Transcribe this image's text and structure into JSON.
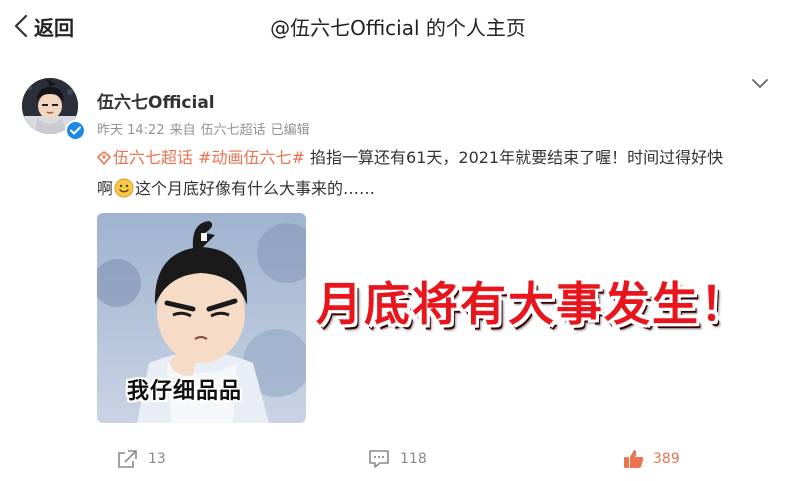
{
  "topbar": {
    "back_label": "返回",
    "title": "@伍六七Official 的个人主页"
  },
  "post": {
    "author": "伍六七Official",
    "verified": true,
    "meta": {
      "time": "昨天 14:22",
      "source_prefix": "来自",
      "source": "伍六七超话",
      "edited": "已编辑"
    },
    "body": {
      "super_topic": "伍六七超话",
      "hashtag": "#动画伍六七#",
      "text_line1": "掐指一算还有61天，2021年就要结束了喔！时间过得好快",
      "text_line2_start": "啊",
      "emoji": "smile-emoji",
      "text_line2_end": "这个月底好像有什么大事来的……"
    },
    "image": {
      "caption": "我仔细品品"
    },
    "overlay_text": "月底将有大事发生！",
    "actions": {
      "share_count": "13",
      "comment_count": "118",
      "like_count": "389"
    }
  },
  "colors": {
    "accent": "#eb7350",
    "verified": "#1e88e5",
    "overlay": "#e8151c"
  }
}
